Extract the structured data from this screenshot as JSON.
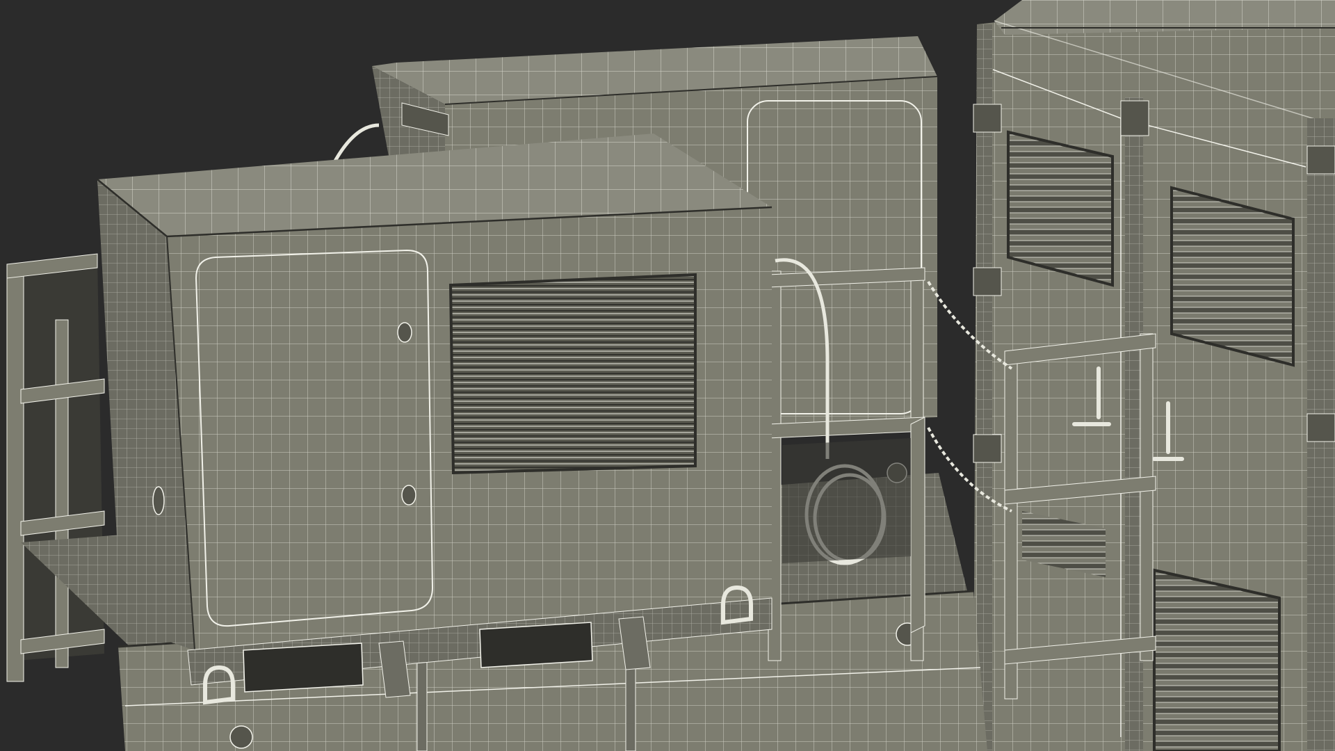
{
  "scene": {
    "subject": "wireframe-render-ground-equipment",
    "colors": {
      "background": "#2b2b2b",
      "surface": "#7d7d70",
      "surface_light": "#8a8a7e",
      "surface_dark": "#5f5f55",
      "shadow": "#3a3a35",
      "wire": "#f2f2ea",
      "edge": "#2e2e2a"
    }
  }
}
